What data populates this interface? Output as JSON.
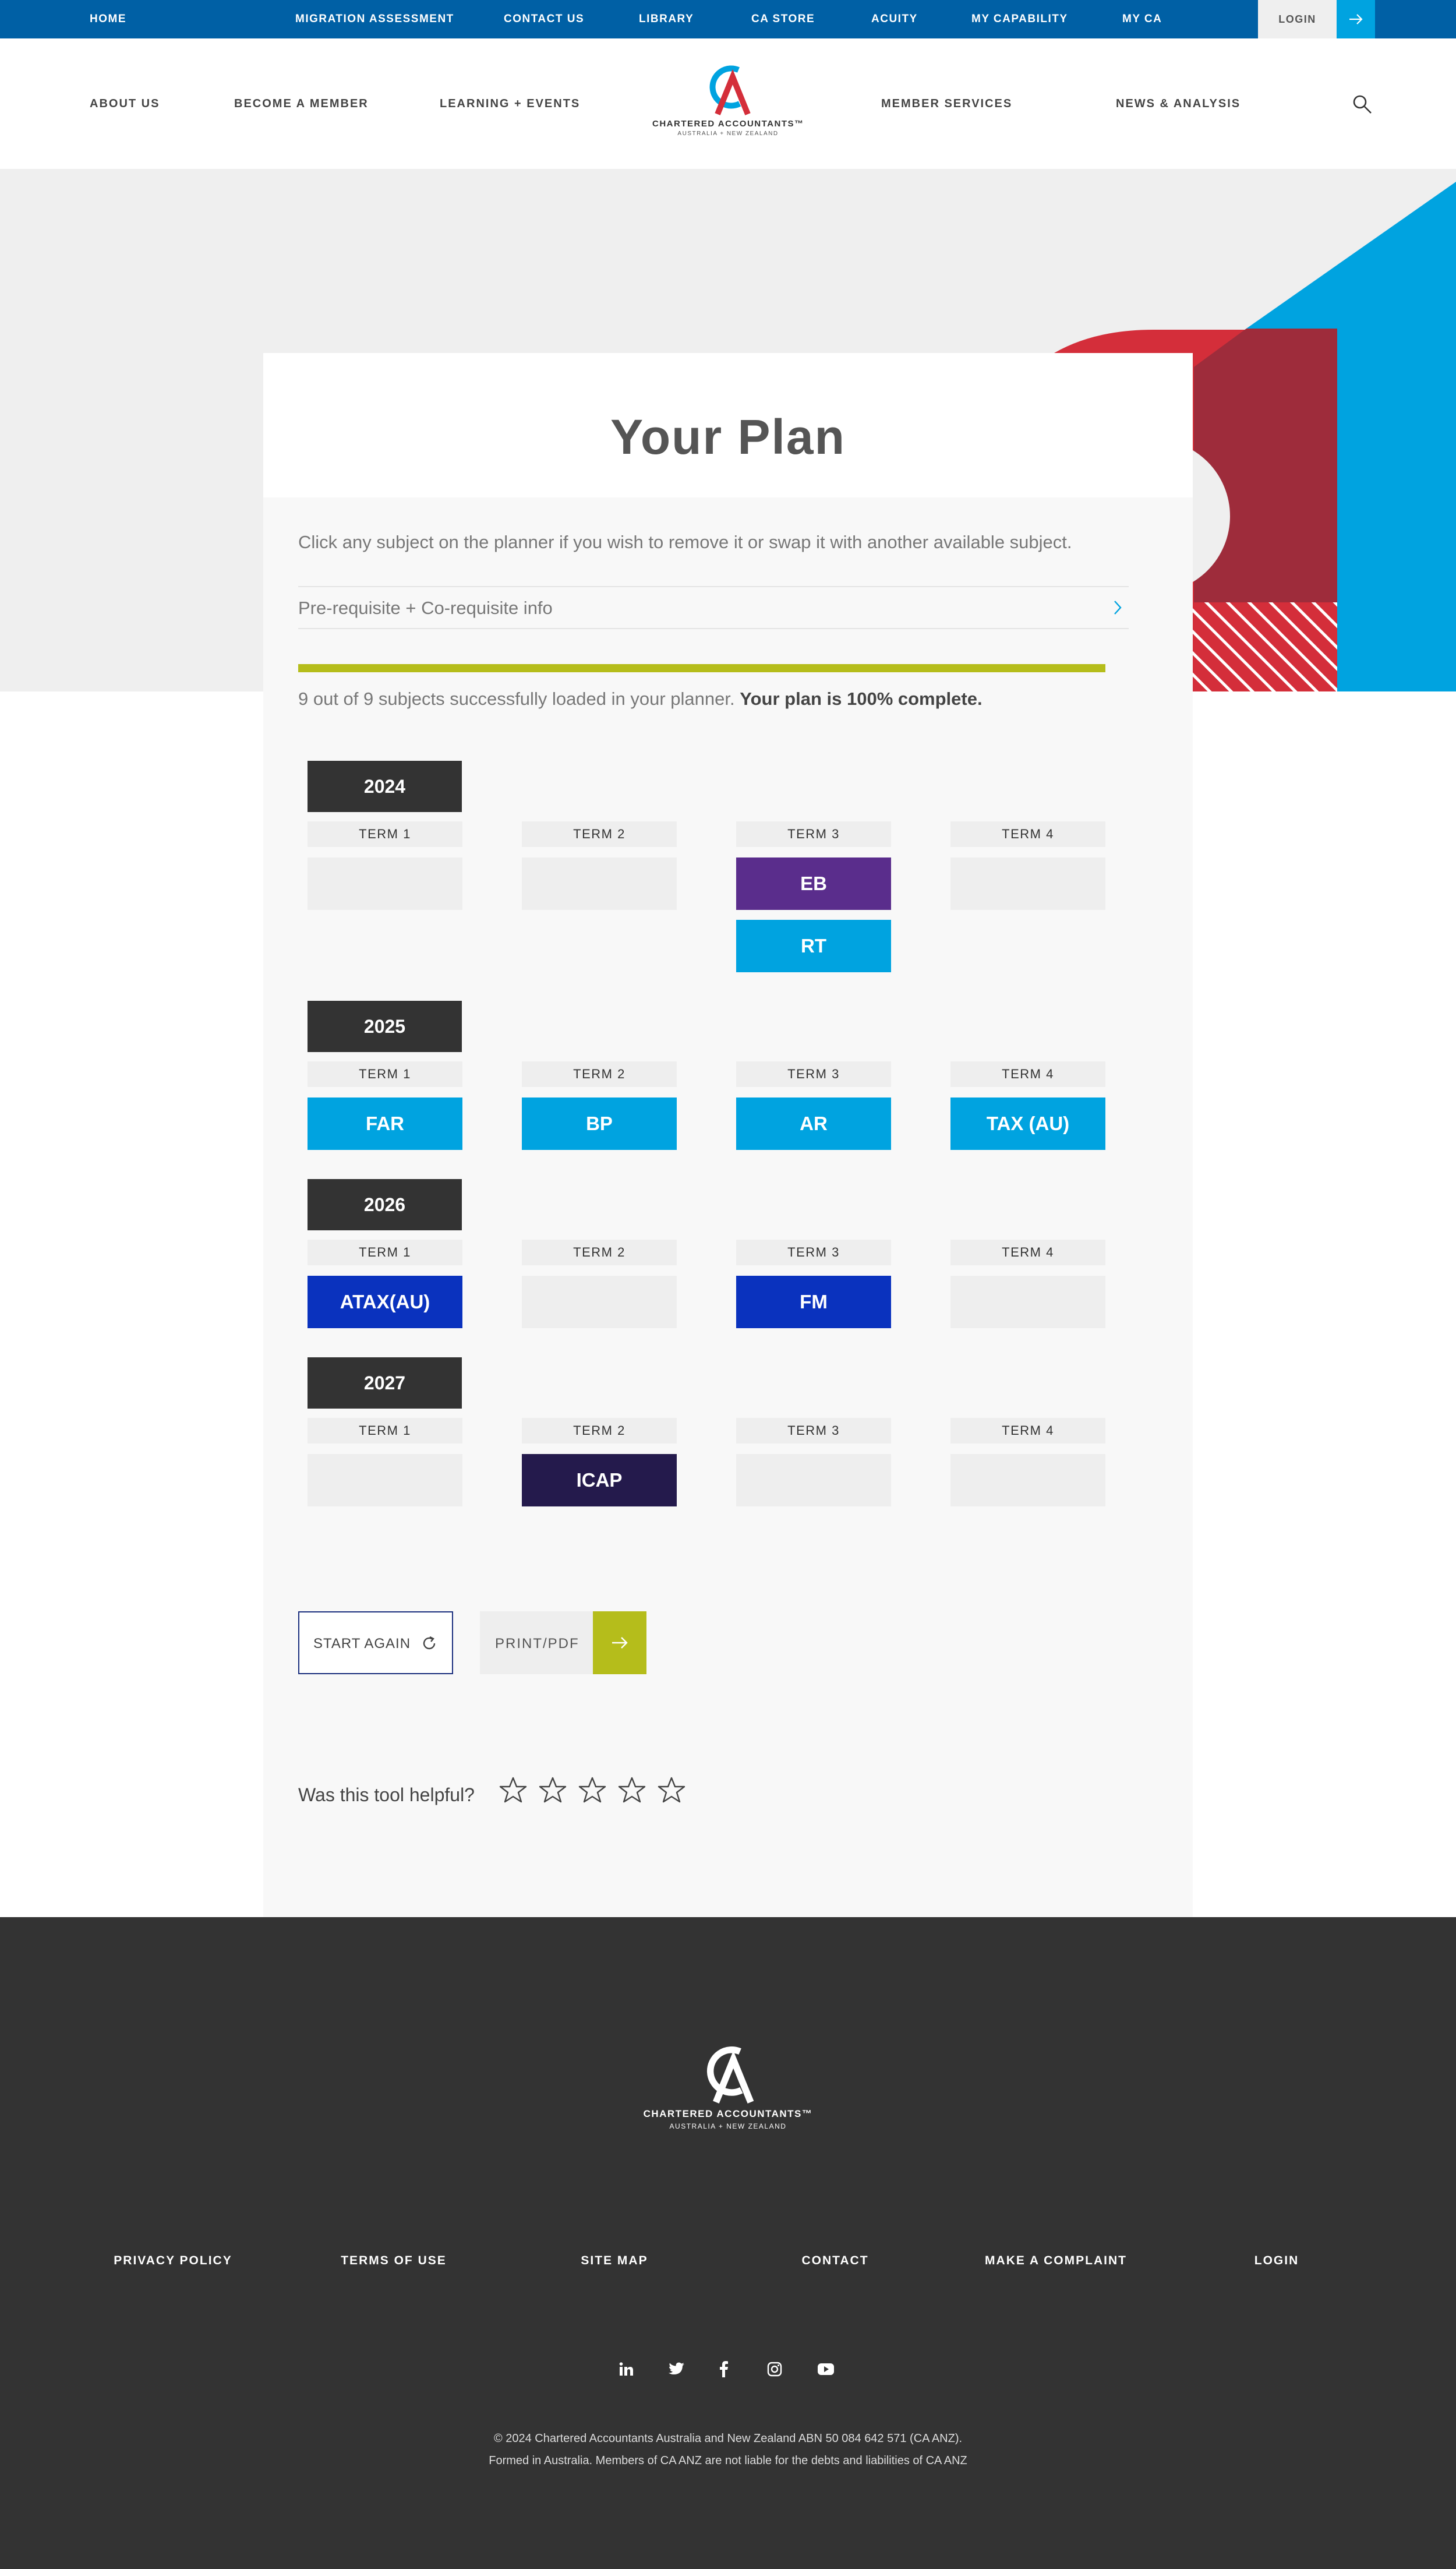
{
  "topbar": {
    "links": [
      "HOME",
      "MIGRATION ASSESSMENT",
      "CONTACT US",
      "LIBRARY",
      "CA STORE",
      "ACUITY",
      "MY CAPABILITY",
      "MY CA"
    ],
    "login": "LOGIN"
  },
  "nav": {
    "left": [
      "ABOUT US",
      "BECOME A MEMBER",
      "LEARNING + EVENTS"
    ],
    "right": [
      "MEMBER SERVICES",
      "NEWS & ANALYSIS"
    ]
  },
  "logo": {
    "line1": "CHARTERED ACCOUNTANTS™",
    "line2": "AUSTRALIA + NEW ZEALAND"
  },
  "icons": {
    "search": "search-icon",
    "arrow": "arrow-right-icon",
    "chevron": "chevron-right-icon",
    "refresh": "refresh-icon",
    "star": "star-outline-icon"
  },
  "colors": {
    "brand_blue": "#0060a5",
    "accent_cyan": "#00a3e0",
    "accent_red": "#d42e3a",
    "lime": "#b5bd1b",
    "purple": "#5a2d8c",
    "royal_blue": "#0a32be",
    "navy": "#241a4c"
  },
  "plan": {
    "title": "Your Plan",
    "intro": "Click any subject on the planner if you wish to remove it or swap it with another available subject.",
    "prereq_label": "Pre-requisite + Co-requisite info",
    "progress_fraction": 1.0,
    "status_text": "9 out of 9 subjects successfully loaded in your planner.",
    "status_bold": "Your plan is 100% complete.",
    "years": [
      {
        "year": "2024",
        "terms": [
          {
            "label": "TERM 1",
            "subjects": []
          },
          {
            "label": "TERM 2",
            "subjects": []
          },
          {
            "label": "TERM 3",
            "subjects": [
              {
                "code": "EB",
                "color": "#5a2d8c"
              },
              {
                "code": "RT",
                "color": "#00a3e0"
              }
            ]
          },
          {
            "label": "TERM 4",
            "subjects": []
          }
        ]
      },
      {
        "year": "2025",
        "terms": [
          {
            "label": "TERM 1",
            "subjects": [
              {
                "code": "FAR",
                "color": "#00a3e0"
              }
            ]
          },
          {
            "label": "TERM 2",
            "subjects": [
              {
                "code": "BP",
                "color": "#00a3e0"
              }
            ]
          },
          {
            "label": "TERM 3",
            "subjects": [
              {
                "code": "AR",
                "color": "#00a3e0"
              }
            ]
          },
          {
            "label": "TERM 4",
            "subjects": [
              {
                "code": "TAX (AU)",
                "color": "#00a3e0"
              }
            ]
          }
        ]
      },
      {
        "year": "2026",
        "terms": [
          {
            "label": "TERM 1",
            "subjects": [
              {
                "code": "ATAX(AU)",
                "color": "#0a32be"
              }
            ]
          },
          {
            "label": "TERM 2",
            "subjects": []
          },
          {
            "label": "TERM 3",
            "subjects": [
              {
                "code": "FM",
                "color": "#0a32be"
              }
            ]
          },
          {
            "label": "TERM 4",
            "subjects": []
          }
        ]
      },
      {
        "year": "2027",
        "terms": [
          {
            "label": "TERM 1",
            "subjects": []
          },
          {
            "label": "TERM 2",
            "subjects": [
              {
                "code": "ICAP",
                "color": "#241a4c"
              }
            ]
          },
          {
            "label": "TERM 3",
            "subjects": []
          },
          {
            "label": "TERM 4",
            "subjects": []
          }
        ]
      }
    ],
    "start_again": "START AGAIN",
    "print_pdf": "PRINT/PDF",
    "helpful_question": "Was this tool helpful?",
    "rating_max": 5,
    "rating_value": 0
  },
  "footer": {
    "links": [
      "PRIVACY POLICY",
      "TERMS OF USE",
      "SITE MAP",
      "CONTACT",
      "MAKE A COMPLAINT",
      "LOGIN"
    ],
    "social": [
      "linkedin-icon",
      "twitter-icon",
      "facebook-icon",
      "instagram-icon",
      "youtube-icon"
    ],
    "copyright_line1": "© 2024 Chartered Accountants Australia and New Zealand ABN 50 084 642 571 (CA ANZ).",
    "copyright_line2": "Formed in Australia. Members of CA ANZ are not liable for the debts and liabilities of CA ANZ"
  }
}
